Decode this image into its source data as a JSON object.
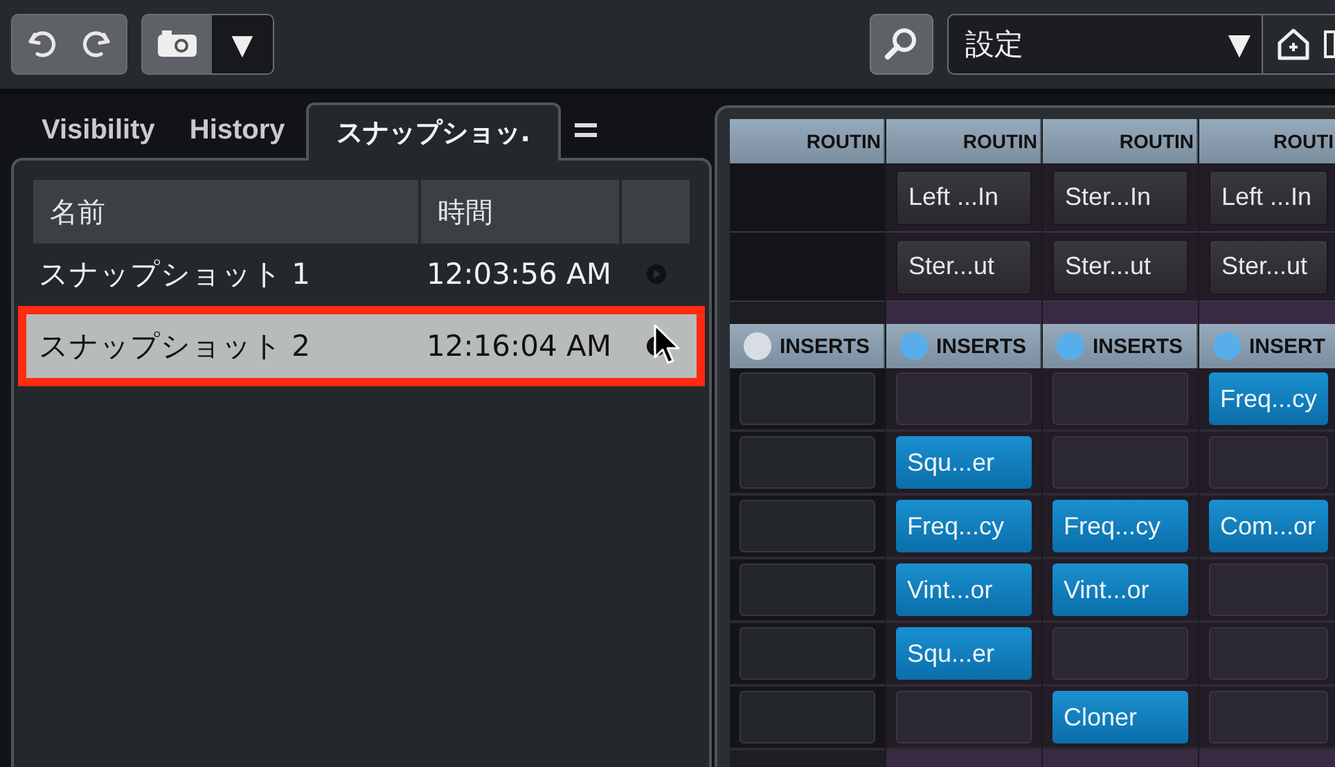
{
  "toolbar": {
    "preset": {
      "value": "設定",
      "arrow": "▼"
    },
    "snapshot_arrow": "▼"
  },
  "tabs": [
    {
      "label": "Visibility",
      "selected": false
    },
    {
      "label": "History",
      "selected": false
    },
    {
      "label": "スナップショッ.",
      "selected": true
    }
  ],
  "snapshots": {
    "columns": [
      "名前",
      "時間"
    ],
    "rows": [
      {
        "name": "スナップショット 1",
        "time": "12:03:56 AM",
        "selected": false,
        "annotated": false
      },
      {
        "name": "スナップショット 2",
        "time": "12:16:04 AM",
        "selected": true,
        "annotated": true
      }
    ]
  },
  "mixer": {
    "channels": [
      {
        "routing": "ROUTIN",
        "inserts_label": "INSERTS",
        "inserts_on": false,
        "inserts": [
          {
            "kind": "empty"
          },
          {
            "kind": "empty"
          },
          {
            "kind": "empty"
          },
          {
            "kind": "empty"
          },
          {
            "kind": "empty"
          },
          {
            "kind": "empty"
          }
        ]
      },
      {
        "routing": "ROUTIN",
        "input": "Left ...In",
        "output": "Ster...ut",
        "inserts_label": "INSERTS",
        "inserts_on": true,
        "inserts": [
          {
            "kind": "empty"
          },
          {
            "kind": "plugin",
            "name": "Squ...er"
          },
          {
            "kind": "plugin",
            "name": "Freq...cy"
          },
          {
            "kind": "plugin",
            "name": "Vint...or"
          },
          {
            "kind": "plugin",
            "name": "Squ...er"
          },
          {
            "kind": "empty"
          }
        ]
      },
      {
        "routing": "ROUTIN",
        "input": "Ster...In",
        "output": "Ster...ut",
        "inserts_label": "INSERTS",
        "inserts_on": true,
        "inserts": [
          {
            "kind": "empty"
          },
          {
            "kind": "empty"
          },
          {
            "kind": "plugin",
            "name": "Freq...cy"
          },
          {
            "kind": "plugin",
            "name": "Vint...or"
          },
          {
            "kind": "empty"
          },
          {
            "kind": "plugin",
            "name": "Cloner"
          }
        ]
      },
      {
        "routing": "ROUTI",
        "input": "Left ...In",
        "output": "Ster...ut",
        "inserts_label": "INSERT",
        "inserts_on": true,
        "inserts": [
          {
            "kind": "plugin",
            "name": "Freq...cy"
          },
          {
            "kind": "empty"
          },
          {
            "kind": "plugin",
            "name": "Com...or"
          },
          {
            "kind": "empty"
          },
          {
            "kind": "empty"
          },
          {
            "kind": "empty"
          }
        ]
      }
    ]
  }
}
